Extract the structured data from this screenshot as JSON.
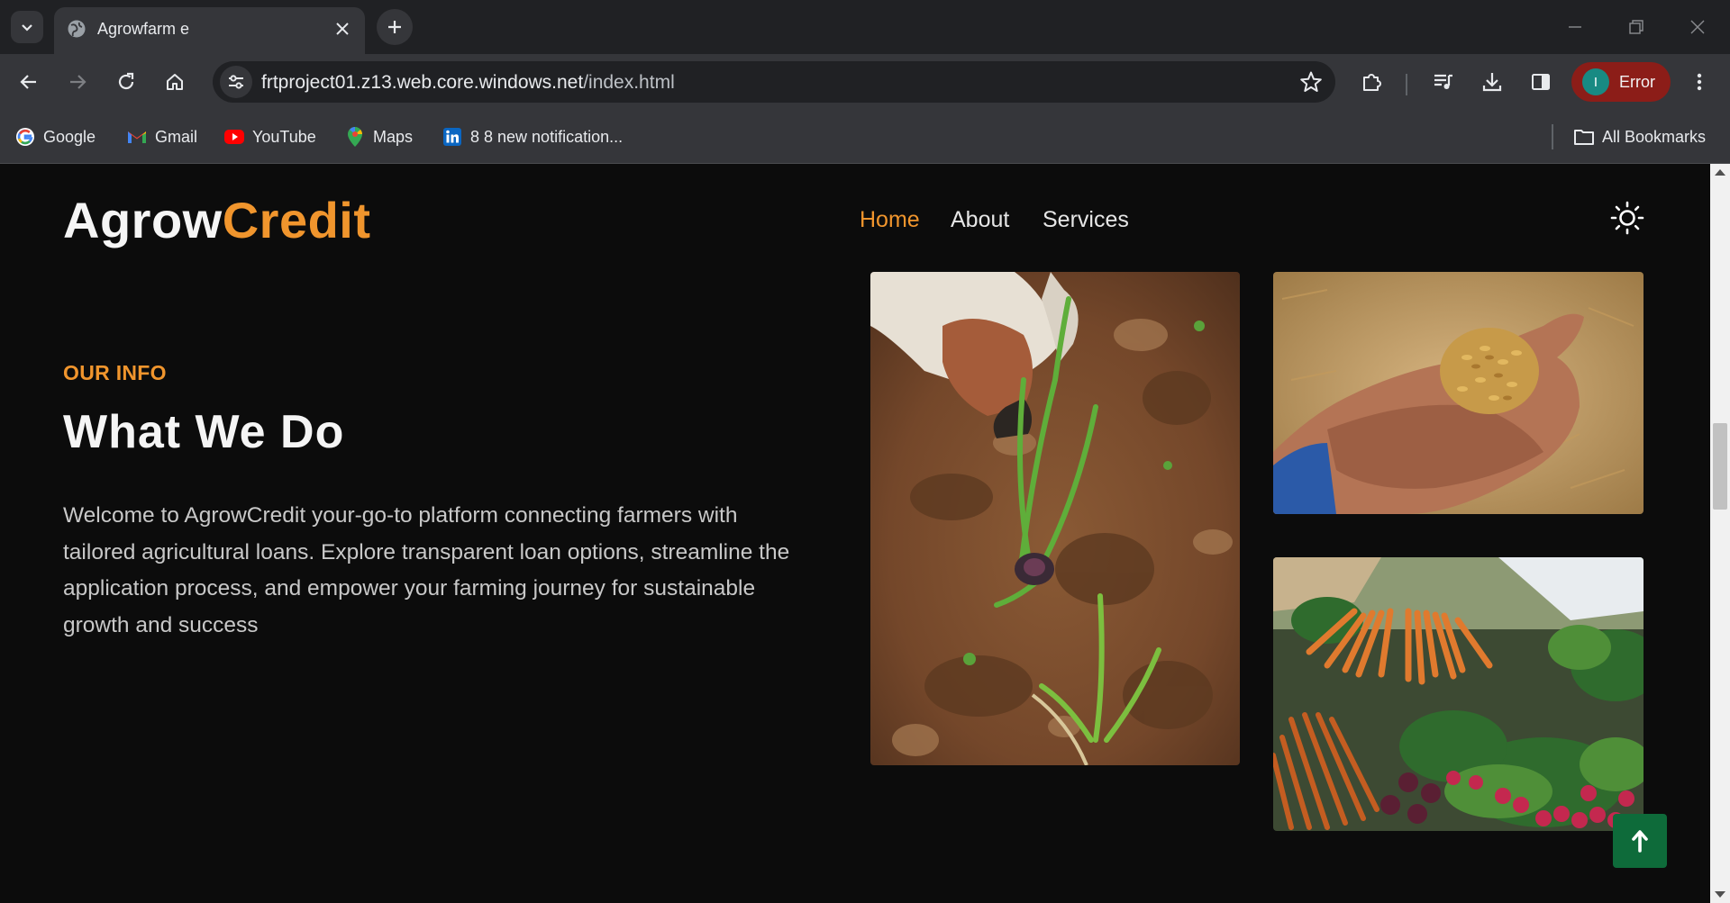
{
  "browser": {
    "tab_title": "Agrowfarm e",
    "url_host": "frtproject01.z13.web.core.windows.net",
    "url_path": "/index.html",
    "profile_initial": "I",
    "profile_status": "Error",
    "bookmarks": [
      {
        "label": "Google",
        "icon": "google-icon"
      },
      {
        "label": "Gmail",
        "icon": "gmail-icon"
      },
      {
        "label": "YouTube",
        "icon": "youtube-icon"
      },
      {
        "label": "Maps",
        "icon": "maps-icon"
      },
      {
        "label": "8 8 new notification...",
        "icon": "linkedin-icon"
      }
    ],
    "all_bookmarks": "All Bookmarks"
  },
  "site": {
    "logo_part1": "Agrow",
    "logo_part2": "Credit",
    "nav": [
      "Home",
      "About",
      "Services"
    ],
    "active_nav": "Home",
    "accent_color": "#f0952d",
    "theme_toggle_icon": "sun-icon"
  },
  "section": {
    "eyebrow": "OUR INFO",
    "heading": "What We Do",
    "body": "Welcome to AgrowCredit your-go-to platform connecting farmers with tailored agricultural loans. Explore transparent loan options, streamline the application process, and empower your farming journey for sustainable growth and success"
  },
  "images": [
    {
      "name": "planting-seedling-photo",
      "subject": "hands planting onion seedlings in soil"
    },
    {
      "name": "grain-in-hand-photo",
      "subject": "hand holding grains"
    },
    {
      "name": "vegetables-market-photo",
      "subject": "carrots and radishes at market"
    }
  ],
  "scroll_to_top_icon": "arrow-up-icon"
}
